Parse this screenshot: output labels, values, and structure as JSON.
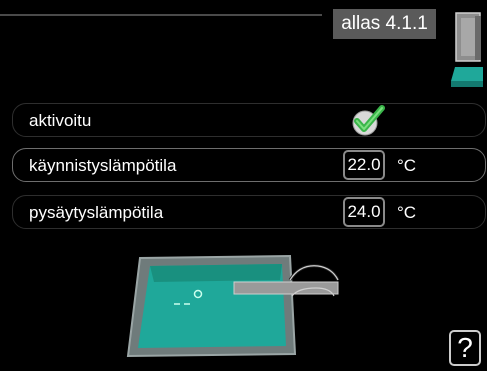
{
  "header": {
    "menu_code": "allas 4.1.1"
  },
  "icons": {
    "device": "heat-pump-icon",
    "tray": "menu-tab-icon",
    "check": "checkmark-icon",
    "help": "help-icon",
    "pool": "pool-illustration"
  },
  "rows": [
    {
      "label": "aktivoitu",
      "checked": true
    },
    {
      "label": "käynnistyslämpötila",
      "value": "22.0",
      "unit": "°C"
    },
    {
      "label": "pysäytyslämpötila",
      "value": "24.0",
      "unit": "°C"
    }
  ],
  "help": {
    "label": "?"
  },
  "colors": {
    "accent": "#1fa89a",
    "check_green": "#3ab54a",
    "value_border": "#8a8a8a"
  }
}
